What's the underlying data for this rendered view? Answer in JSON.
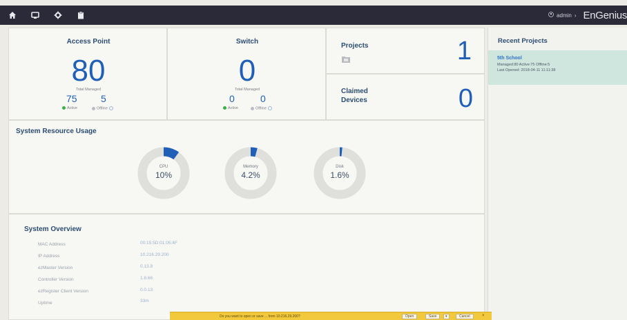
{
  "topbar": {
    "icons": [
      "home-icon",
      "monitor-icon",
      "gear-icon",
      "clipboard-icon"
    ],
    "user": "admin",
    "brand": "EnGenius"
  },
  "access_point": {
    "title": "Access Point",
    "total": "80",
    "total_label": "Total Managed",
    "active": "75",
    "active_label": "Active",
    "offline": "5",
    "offline_label": "Offline"
  },
  "switch": {
    "title": "Switch",
    "total": "0",
    "total_label": "Total Managed",
    "active": "0",
    "active_label": "Active",
    "offline": "0",
    "offline_label": "Offline"
  },
  "projects": {
    "title": "Projects",
    "count": "1"
  },
  "claimed": {
    "title_line1": "Claimed",
    "title_line2": "Devices",
    "count": "0"
  },
  "resources": {
    "title": "System Resource Usage",
    "items": [
      {
        "label": "CPU",
        "value": "10%",
        "fraction": 0.1
      },
      {
        "label": "Memory",
        "value": "4.2%",
        "fraction": 0.042
      },
      {
        "label": "Disk",
        "value": "1.6%",
        "fraction": 0.016
      }
    ]
  },
  "overview": {
    "title": "System Overview",
    "rows": [
      {
        "label": "MAC Address",
        "value": "00:15:5D:01:05:4F"
      },
      {
        "label": "IP Address",
        "value": "10.216.29.200"
      },
      {
        "label": "ezMaster Version",
        "value": "0.13.8"
      },
      {
        "label": "Controller Version",
        "value": "1.8.66"
      },
      {
        "label": "ezRegister Client Version",
        "value": "0.0.13"
      },
      {
        "label": "Uptime",
        "value": "33m"
      }
    ]
  },
  "recent_projects": {
    "title": "Recent Projects",
    "project_name": "5th School",
    "meta_line1": "Managed:80   Active:75   Offline:5",
    "meta_line2": "Last Opened: 2018-04-11 11:11:38"
  },
  "download_bar": {
    "text": "Do you want to open or save ... from 10.216.29.200?",
    "open_label": "Open",
    "save_label": "Save",
    "cancel_label": "Cancel"
  },
  "colors": {
    "accent": "#1f5fb8",
    "active": "#3cae4a",
    "offline": "#b9bdc3",
    "topbar": "#2b2a38",
    "recent_bg": "#cfe6df"
  }
}
